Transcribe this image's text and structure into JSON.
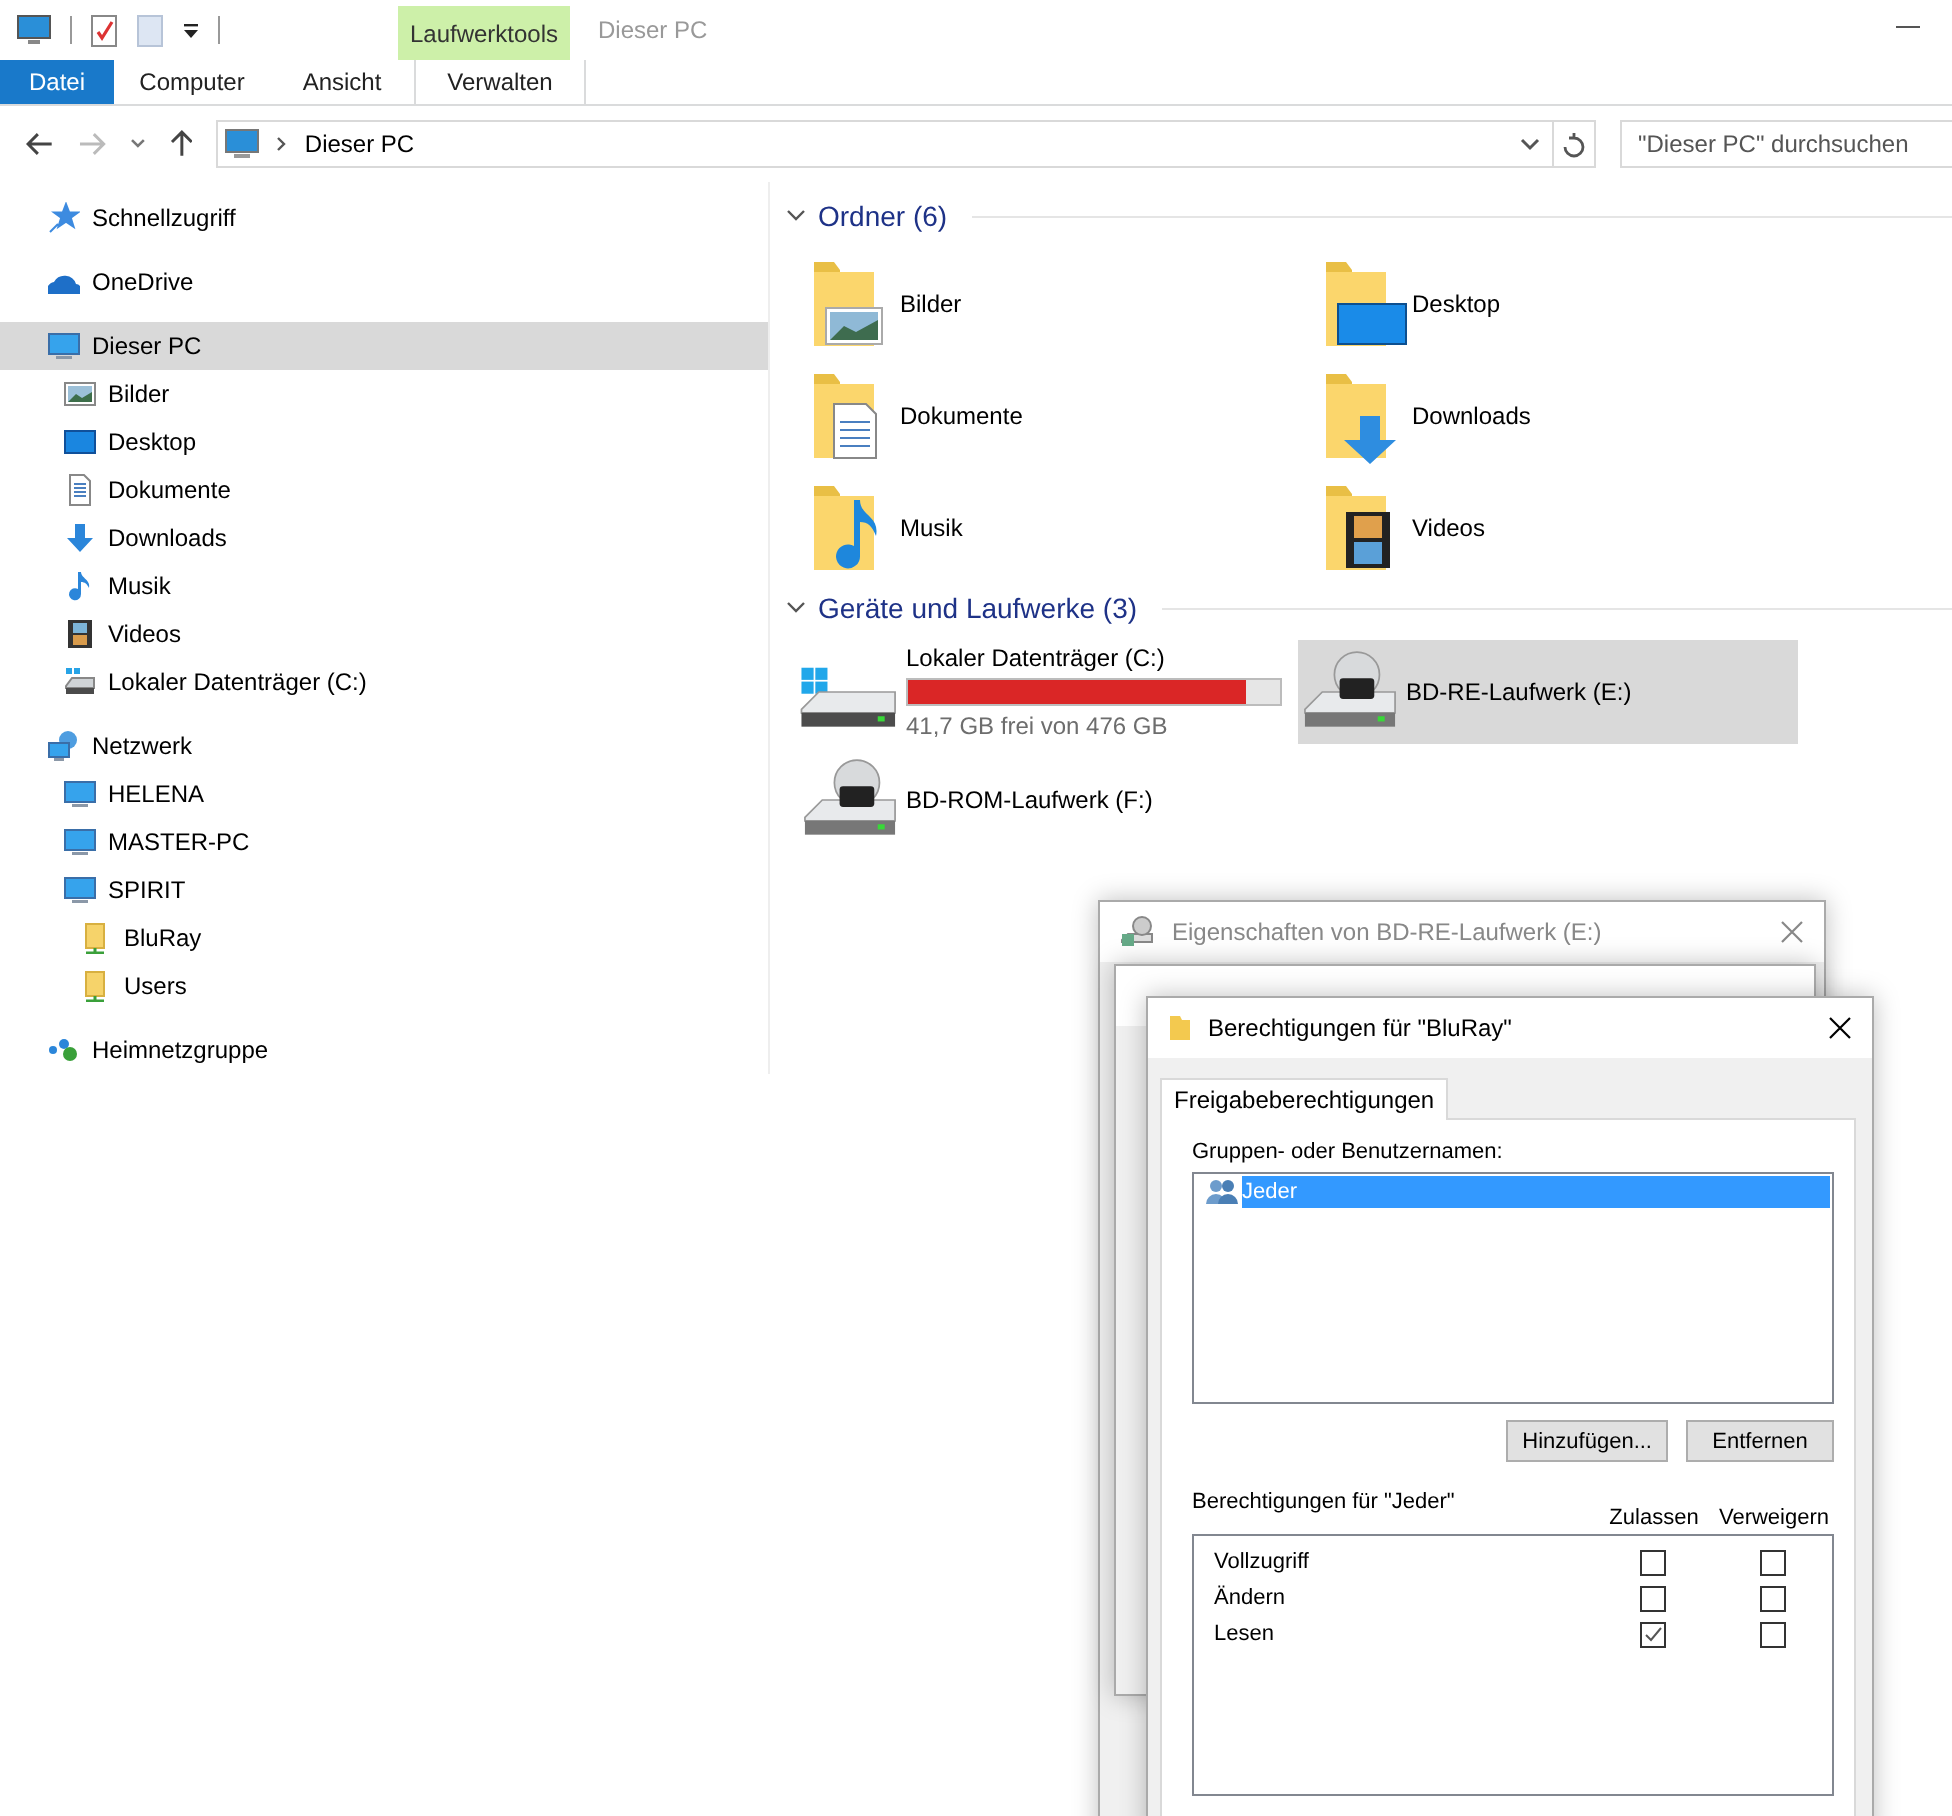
{
  "window": {
    "title": "Dieser PC"
  },
  "ribbon": {
    "context_group": "Laufwerktools",
    "tabs": [
      {
        "label": "Datei",
        "kind": "file"
      },
      {
        "label": "Computer",
        "kind": "tab"
      },
      {
        "label": "Ansicht",
        "kind": "tab"
      },
      {
        "label": "Verwalten",
        "kind": "context"
      }
    ]
  },
  "address_bar": {
    "path": "Dieser PC"
  },
  "search": {
    "placeholder": "\"Dieser PC\" durchsuchen"
  },
  "sidebar": {
    "items": [
      {
        "label": "Schnellzugriff",
        "selected": false
      },
      {
        "label": "OneDrive",
        "selected": false
      },
      {
        "label": "Dieser PC",
        "selected": true,
        "children": [
          {
            "label": "Bilder",
            "selected": false
          },
          {
            "label": "Desktop",
            "selected": false
          },
          {
            "label": "Dokumente",
            "selected": false
          },
          {
            "label": "Downloads",
            "selected": false
          },
          {
            "label": "Musik",
            "selected": false
          },
          {
            "label": "Videos",
            "selected": false
          },
          {
            "label": "Lokaler Datenträger (C:)",
            "selected": false
          }
        ]
      },
      {
        "label": "Netzwerk",
        "selected": false,
        "children": [
          {
            "label": "HELENA",
            "selected": false
          },
          {
            "label": "MASTER-PC",
            "selected": false
          },
          {
            "label": "SPIRIT",
            "selected": false,
            "children": [
              {
                "label": "BluRay",
                "selected": false
              },
              {
                "label": "Users",
                "selected": false
              }
            ]
          }
        ]
      },
      {
        "label": "Heimnetzgruppe",
        "selected": false
      }
    ]
  },
  "groups": [
    {
      "title": "Ordner (6)",
      "kind": "folders",
      "expanded": true,
      "items": [
        {
          "label": "Bilder",
          "selected": false
        },
        {
          "label": "Desktop",
          "selected": false
        },
        {
          "label": "Dokumente",
          "selected": false
        },
        {
          "label": "Downloads",
          "selected": false
        },
        {
          "label": "Musik",
          "selected": false
        },
        {
          "label": "Videos",
          "selected": false
        }
      ]
    },
    {
      "title": "Geräte und Laufwerke (3)",
      "kind": "drives",
      "expanded": true,
      "items": [
        {
          "label": "Lokaler Datenträger (C:)",
          "selected": false,
          "level": 0.91,
          "free": "41,7 GB frei von 476 GB"
        },
        {
          "label": "BD-RE-Laufwerk (E:)",
          "selected": true
        },
        {
          "label": "BD-ROM-Laufwerk (F:)",
          "selected": false
        }
      ]
    }
  ],
  "background_dialogs": [
    {
      "title": "Eigenschaften von BD-RE-Laufwerk (E:)",
      "active": false
    }
  ],
  "permissions_dialog": {
    "title": "Berechtigungen für \"BluRay\"",
    "active": true,
    "tabs": [
      {
        "label": "Freigabeberechtigungen",
        "selected": true
      }
    ],
    "groups_label": "Gruppen- oder Benutzernamen:",
    "principals": [
      {
        "name": "Jeder",
        "selected": true
      }
    ],
    "buttons": [
      "Hinzufügen...",
      "Entfernen"
    ],
    "permissions_label": "Berechtigungen für \"Jeder\"",
    "columns": [
      "Zulassen",
      "Verweigern"
    ],
    "permissions": [
      {
        "name": "Vollzugriff",
        "allow": false,
        "deny": false
      },
      {
        "name": "Ändern",
        "allow": false,
        "deny": false
      },
      {
        "name": "Lesen",
        "allow": true,
        "deny": false
      }
    ]
  }
}
